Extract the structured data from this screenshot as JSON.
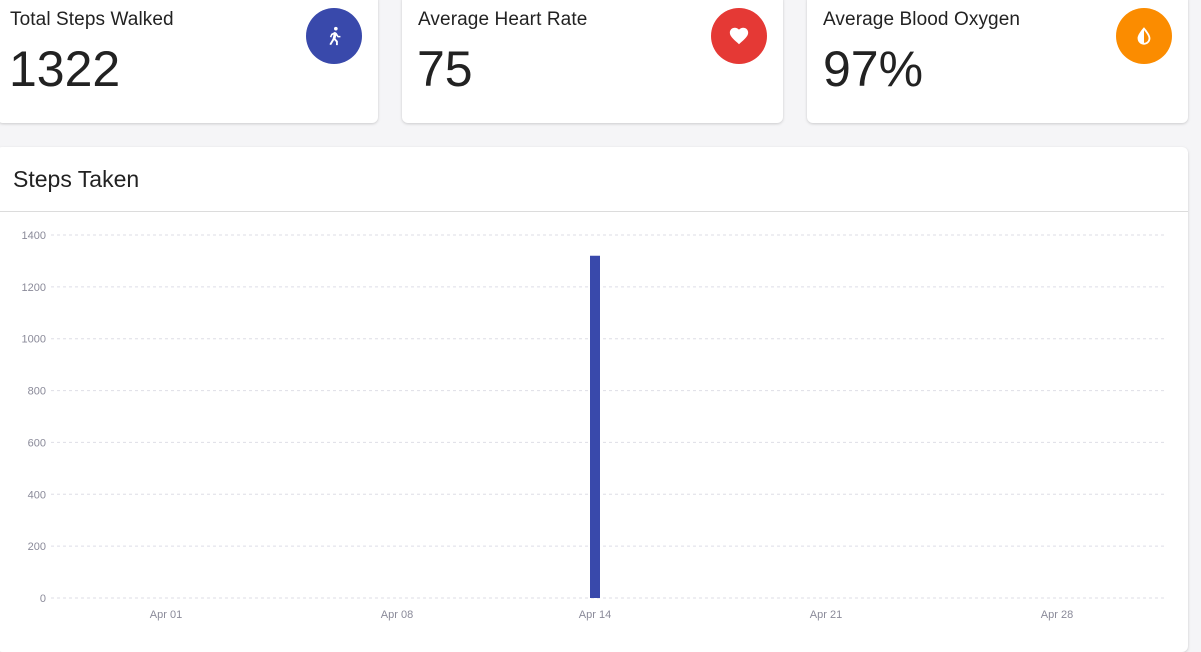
{
  "stats": [
    {
      "title": "Total Steps Walked",
      "value": "1322",
      "icon": "running-icon",
      "color": "#3949ab"
    },
    {
      "title": "Average Heart Rate",
      "value": "75",
      "icon": "heart-icon",
      "color": "#e53935"
    },
    {
      "title": "Average Blood Oxygen",
      "value": "97%",
      "icon": "blood-drop-icon",
      "color": "#fb8c00"
    }
  ],
  "chart_data": {
    "type": "bar",
    "title": "Steps Taken",
    "x": [
      "Apr 14"
    ],
    "values": [
      1320
    ],
    "x_ticks": [
      "Apr 01",
      "Apr 08",
      "Apr 14",
      "Apr 21",
      "Apr 28"
    ],
    "y_ticks": [
      0,
      200,
      400,
      600,
      800,
      1000,
      1200,
      1400
    ],
    "ylim": [
      0,
      1400
    ],
    "grid": true,
    "bar_color": "#3949ab"
  }
}
